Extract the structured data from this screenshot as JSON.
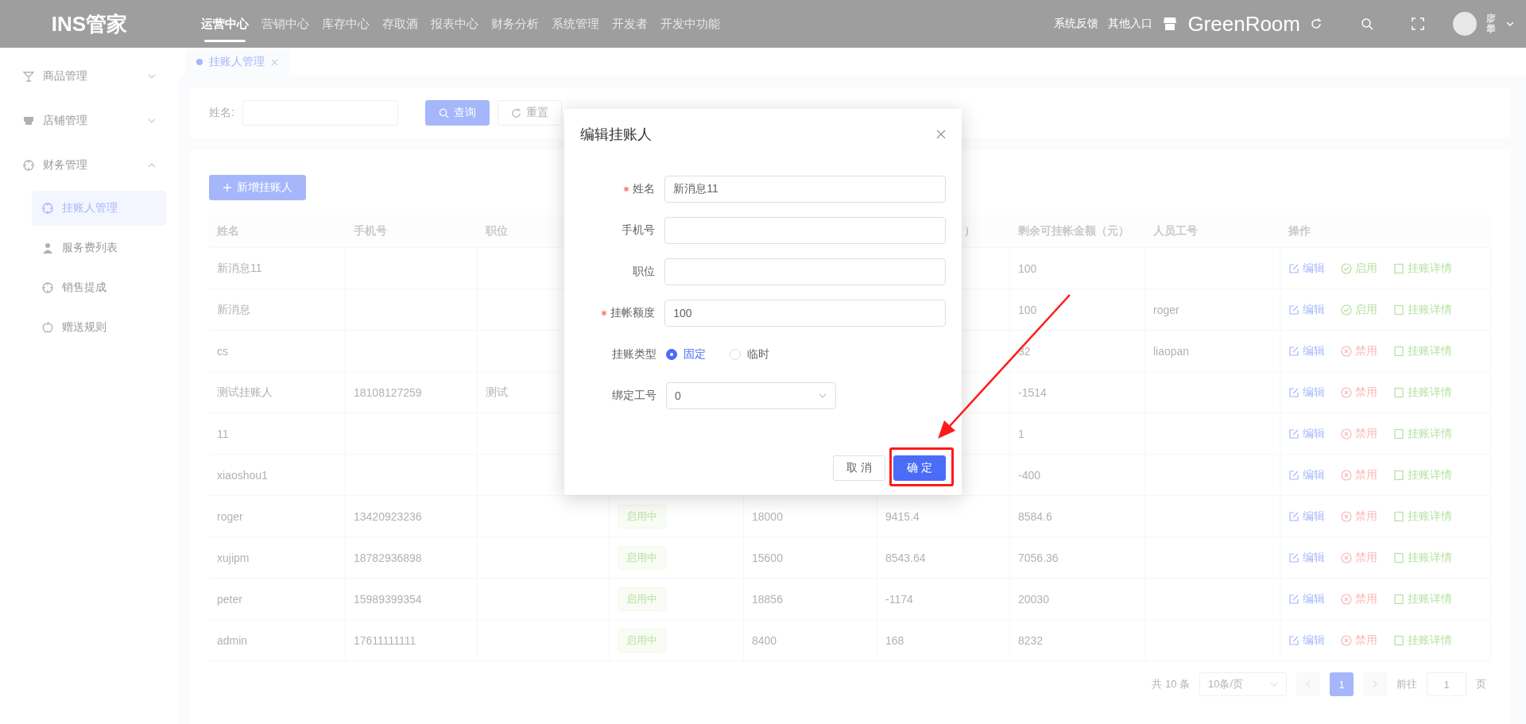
{
  "top_bar": {
    "logo": "INS管家",
    "nav": [
      {
        "label": "运营中心",
        "selected": true
      },
      {
        "label": "营销中心",
        "selected": false
      },
      {
        "label": "库存中心",
        "selected": false
      },
      {
        "label": "存取酒",
        "selected": false
      },
      {
        "label": "报表中心",
        "selected": false
      },
      {
        "label": "财务分析",
        "selected": false
      },
      {
        "label": "系统管理",
        "selected": false
      },
      {
        "label": "开发者",
        "selected": false
      },
      {
        "label": "开发中功能",
        "selected": false
      }
    ],
    "links": [
      "系统反馈",
      "其他入口"
    ],
    "store_name": "GreenRoom",
    "user_name": "廖攀"
  },
  "sidebar": {
    "items": [
      {
        "label": "商品管理",
        "expanded": false
      },
      {
        "label": "店铺管理",
        "expanded": false
      },
      {
        "label": "财务管理",
        "expanded": true,
        "children": [
          {
            "label": "挂账人管理",
            "selected": true
          },
          {
            "label": "服务费列表",
            "selected": false
          },
          {
            "label": "销售提成",
            "selected": false
          },
          {
            "label": "赠送规则",
            "selected": false
          }
        ]
      }
    ]
  },
  "tabs": [
    {
      "label": "挂账人管理",
      "selected": true
    }
  ],
  "filter": {
    "label": "姓名:",
    "search_button": "查询",
    "reset_button": "重置"
  },
  "table": {
    "add_button": "新增挂账人",
    "columns": [
      {
        "label": "姓名"
      },
      {
        "label": "手机号"
      },
      {
        "label": "职位"
      },
      {},
      {},
      {
        "label": "）"
      },
      {
        "label": "剩余可挂帐金额（元）"
      },
      {
        "label": "人员工号"
      },
      {
        "label": "操作"
      }
    ],
    "rows": [
      {
        "name": "新消息11",
        "remaining": "100",
        "edit": "编辑",
        "action": {
          "kind": "enable",
          "label": "启用"
        },
        "detail": "挂账详情"
      },
      {
        "name": "新消息",
        "remaining": "100",
        "staff_no": "roger",
        "edit": "编辑",
        "action": {
          "kind": "enable",
          "label": "启用"
        },
        "detail": "挂账详情"
      },
      {
        "name": "cs",
        "remaining": "32",
        "staff_no": "liaopan",
        "edit": "编辑",
        "action": {
          "kind": "disable",
          "label": "禁用"
        },
        "detail": "挂账详情"
      },
      {
        "name": "测试挂账人",
        "phone": "18108127259",
        "position": "测试",
        "remaining": "-1514",
        "edit": "编辑",
        "action": {
          "kind": "disable",
          "label": "禁用"
        },
        "detail": "挂账详情"
      },
      {
        "name": "11",
        "remaining": "1",
        "edit": "编辑",
        "action": {
          "kind": "disable",
          "label": "禁用"
        },
        "detail": "挂账详情"
      },
      {
        "name": "xiaoshou1",
        "remaining": "-400",
        "edit": "编辑",
        "action": {
          "kind": "disable",
          "label": "禁用"
        },
        "detail": "挂账详情"
      },
      {
        "name": "roger",
        "phone": "13420923236",
        "status": "启用中",
        "limit": "18000",
        "used": "9415.4",
        "remaining": "8584.6",
        "edit": "编辑",
        "action": {
          "kind": "disable",
          "label": "禁用"
        },
        "detail": "挂账详情"
      },
      {
        "name": "xujipm",
        "phone": "18782936898",
        "status": "启用中",
        "limit": "15600",
        "used": "8543.64",
        "remaining": "7056.36",
        "edit": "编辑",
        "action": {
          "kind": "disable",
          "label": "禁用"
        },
        "detail": "挂账详情"
      },
      {
        "name": "peter",
        "phone": "15989399354",
        "status": "启用中",
        "limit": "18856",
        "used": "-1174",
        "remaining": "20030",
        "edit": "编辑",
        "action": {
          "kind": "disable",
          "label": "禁用"
        },
        "detail": "挂账详情"
      },
      {
        "name": "admin",
        "phone": "17611111111",
        "status": "启用中",
        "limit": "8400",
        "used": "168",
        "remaining": "8232",
        "edit": "编辑",
        "action": {
          "kind": "disable",
          "label": "禁用"
        },
        "detail": "挂账详情"
      }
    ],
    "pagination": {
      "total": "共 10 条",
      "page_size": "10条/页",
      "pages": [
        {
          "label": "1",
          "selected": true
        }
      ],
      "goto_label": "前往",
      "goto_value": "1",
      "goto_suffix": "页"
    }
  },
  "dialog": {
    "title": "编辑挂账人",
    "fields": [
      {
        "kind": "input",
        "label": "姓名",
        "required": true,
        "value": "新消息11"
      },
      {
        "kind": "input",
        "label": "手机号",
        "required": false
      },
      {
        "kind": "input",
        "label": "职位",
        "required": false
      },
      {
        "kind": "input",
        "label": "挂帐额度",
        "required": true,
        "value": "100"
      },
      {
        "kind": "radio",
        "label": "挂账类型",
        "required": false,
        "options": [
          {
            "label": "固定",
            "selected": true
          },
          {
            "label": "临时",
            "selected": false
          }
        ]
      },
      {
        "kind": "select",
        "label": "绑定工号",
        "required": false,
        "value": "0"
      }
    ],
    "cancel_button": "取 消",
    "confirm_button": "确 定"
  }
}
